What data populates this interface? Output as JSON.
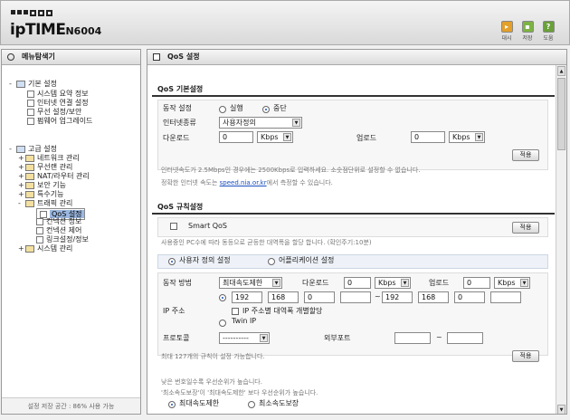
{
  "header": {
    "logo_brand": "ipTIME",
    "logo_model": "N6004",
    "buttons": [
      {
        "label": "대시",
        "icon": "run-icon"
      },
      {
        "label": "저장",
        "icon": "save-icon"
      },
      {
        "label": "도움",
        "icon": "help-icon"
      }
    ]
  },
  "sidebar": {
    "title": "메뉴탐색기",
    "basic_group": "기본 설정",
    "basic_items": [
      "시스템 요약 정보",
      "인터넷 연결 설정",
      "무선 설정/보안",
      "펌웨어 업그레이드"
    ],
    "advanced_group": "고급 설정",
    "advanced_items": [
      "네트워크 관리",
      "무선랜 관리",
      "NAT/라우터 관리",
      "보안 기능",
      "특수기능",
      "트래픽 관리"
    ],
    "traffic_items": [
      "QoS 설정",
      "컨넥션 정보",
      "컨넥션 제어",
      "링크설정/정보"
    ],
    "last_item": "시스템 관리",
    "footer": "설정 저장 공간 : 86% 사용 가능"
  },
  "main": {
    "title": "QoS 설정",
    "basic": {
      "title": "QoS 기본설정",
      "operation_label": "동작 설정",
      "op_run": "실행",
      "op_stop": "중단",
      "inet_type_label": "인터넷종류",
      "inet_type_value": "사용자정의",
      "download_label": "다운로드",
      "download_value": "0",
      "download_unit": "Kbps",
      "upload_label": "업로드",
      "upload_value": "0",
      "upload_unit": "Kbps",
      "apply": "적용",
      "note1": "인터넷속도가 2.5Mbps인 경우에는 2500Kbps로 입력하세요. 소숫점단위로 설정할 수 없습니다.",
      "note2_pre": "정확한 인터넷 속도는 ",
      "note2_link": "speed.nia.or.kr",
      "note2_post": "에서 측정할 수 있습니다."
    },
    "rules": {
      "title": "QoS 규칙설정",
      "smart_qos": "Smart QoS",
      "apply": "적용",
      "smart_note": "사용중인 PC수에 따라 동등으로 균등한 대역폭을 할당 합니다. (확인주기:10분)",
      "tab_user": "사용자 정의 설정",
      "tab_app": "어플리케이션 설정",
      "method_label": "동작 방법",
      "method_value": "최대속도제한",
      "dl_label": "다운로드",
      "dl_value": "0",
      "dl_unit": "Kbps",
      "ul_label": "업로드",
      "ul_value": "0",
      "ul_unit": "Kbps",
      "ip_label": "IP 주소",
      "ip_start": [
        "192",
        "168",
        "0",
        ""
      ],
      "ip_end": [
        "192",
        "168",
        "0",
        ""
      ],
      "ip_separator": "~",
      "ip_per_address": "IP 주소별 대역폭 개별할당",
      "twin_ip": "Twin IP",
      "protocol_label": "프로토콜",
      "protocol_value": "----------",
      "extport_label": "외부포트",
      "port_separator": "~",
      "max_note": "최대 127개의 규칙이 설정 가능합니다.",
      "add": "적용",
      "prio_note1": "낮은 번호일수록 우선순위가 높습니다.",
      "prio_note2": "'최소속도보장'이 '최대속도제한' 보다 우선순위가 높습니다.",
      "filter_max": "최대속도제한",
      "filter_min": "최소속도보장"
    }
  }
}
